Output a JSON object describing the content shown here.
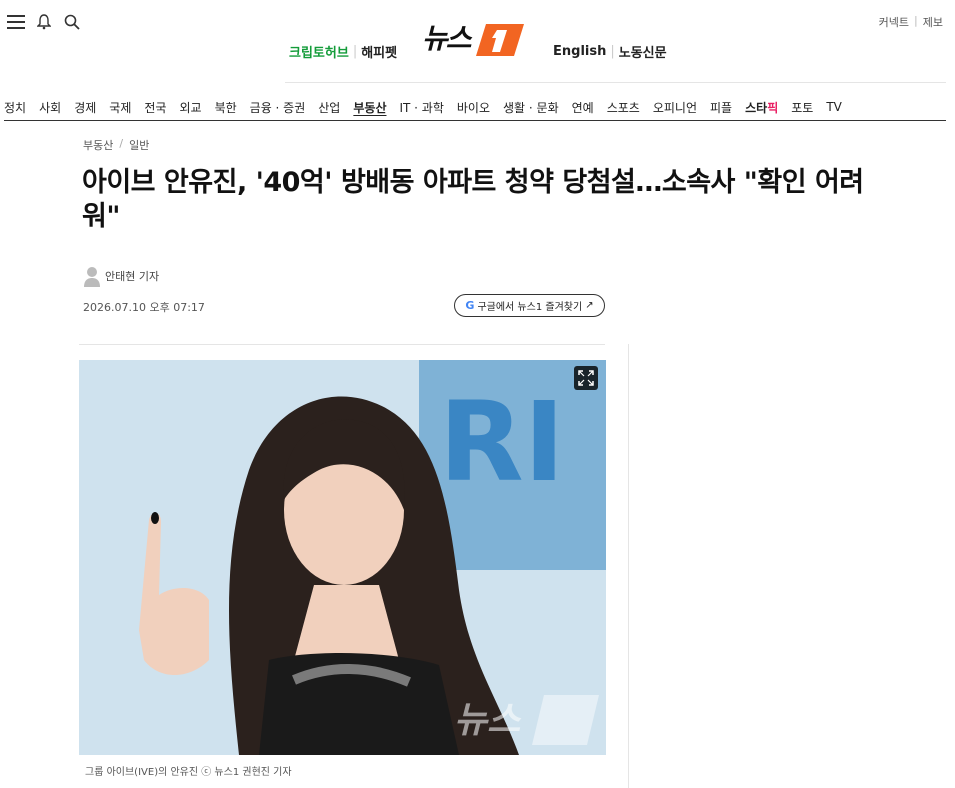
{
  "header": {
    "util_links": [
      "커넥트",
      "제보"
    ],
    "left_links": [
      "크립토허브",
      "해피펫"
    ],
    "right_links": [
      "English",
      "노동신문"
    ],
    "logo_text": "뉴스1"
  },
  "nav": {
    "items": [
      "정치",
      "사회",
      "경제",
      "국제",
      "전국",
      "외교",
      "북한",
      "금융 · 증권",
      "산업",
      "부동산",
      "IT · 과학",
      "바이오",
      "생활 · 문화",
      "연예",
      "스포츠",
      "오피니언",
      "피플"
    ],
    "starpick_main": "스타",
    "starpick_sub": "픽",
    "after": [
      "포토",
      "TV"
    ],
    "active": "부동산"
  },
  "article": {
    "breadcrumb": [
      "부동산",
      "일반"
    ],
    "headline": "아이브 안유진, '40억' 방배동 아파트 청약 당첨설…소속사 \"확인 어려워\"",
    "reporter": "안태현 기자",
    "date": "2026.07.10 오후 07:17",
    "google_button": "구글에서 뉴스1 즐겨찾기",
    "caption": "그룹 아이브(IVE)의 안유진 ⓒ 뉴스1 권현진 기자"
  },
  "colors": {
    "brand_orange": "#f26522",
    "green_link": "#149c3a",
    "photo_bg": "#cfe2ee"
  }
}
